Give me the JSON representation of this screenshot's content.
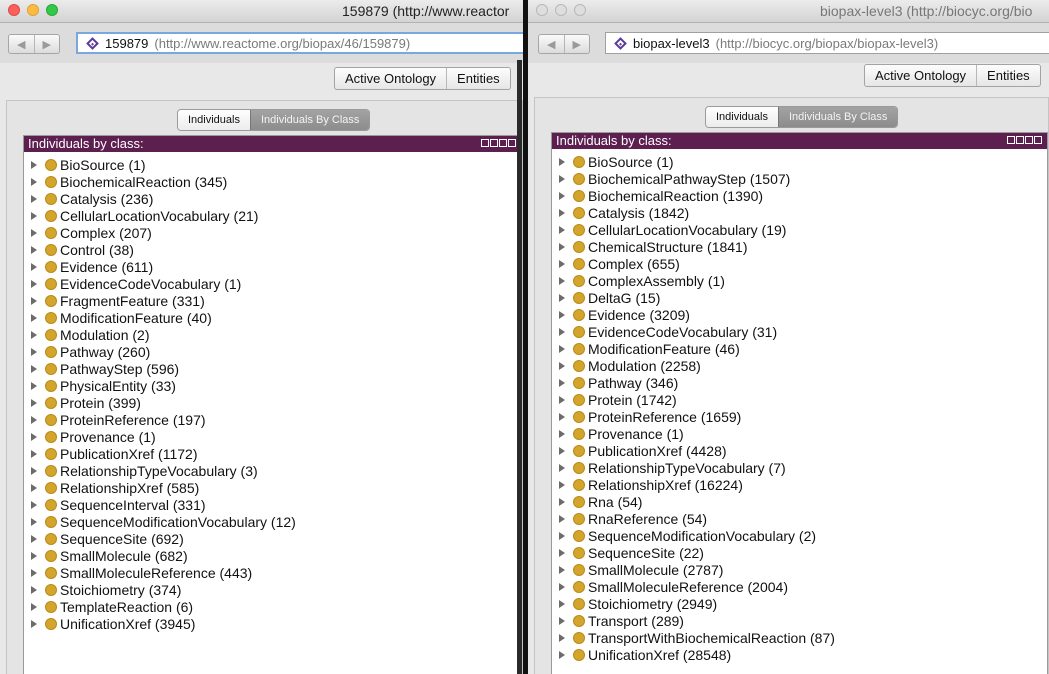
{
  "windows": [
    {
      "title": "159879 (http://www.reactor",
      "address": {
        "name": "159879",
        "url": "(http://www.reactome.org/biopax/46/159879)"
      },
      "tabs": [
        "Active Ontology",
        "Entities"
      ],
      "view_tabs": {
        "individuals": "Individuals",
        "by_class": "Individuals By Class"
      },
      "view_title": "Individuals by class:",
      "items": [
        "BioSource (1)",
        "BiochemicalReaction (345)",
        "Catalysis (236)",
        "CellularLocationVocabulary (21)",
        "Complex (207)",
        "Control (38)",
        "Evidence (611)",
        "EvidenceCodeVocabulary (1)",
        "FragmentFeature (331)",
        "ModificationFeature (40)",
        "Modulation (2)",
        "Pathway (260)",
        "PathwayStep (596)",
        "PhysicalEntity (33)",
        "Protein (399)",
        "ProteinReference (197)",
        "Provenance (1)",
        "PublicationXref (1172)",
        "RelationshipTypeVocabulary (3)",
        "RelationshipXref (585)",
        "SequenceInterval (331)",
        "SequenceModificationVocabulary (12)",
        "SequenceSite (692)",
        "SmallMolecule (682)",
        "SmallMoleculeReference (443)",
        "Stoichiometry (374)",
        "TemplateReaction (6)",
        "UnificationXref (3945)"
      ]
    },
    {
      "title": "biopax-level3 (http://biocyc.org/bio",
      "address": {
        "name": "biopax-level3",
        "url": "(http://biocyc.org/biopax/biopax-level3)"
      },
      "tabs": [
        "Active Ontology",
        "Entities"
      ],
      "view_tabs": {
        "individuals": "Individuals",
        "by_class": "Individuals By Class"
      },
      "view_title": "Individuals by class:",
      "items": [
        "BioSource (1)",
        "BiochemicalPathwayStep (1507)",
        "BiochemicalReaction (1390)",
        "Catalysis (1842)",
        "CellularLocationVocabulary (19)",
        "ChemicalStructure (1841)",
        "Complex (655)",
        "ComplexAssembly (1)",
        "DeltaG (15)",
        "Evidence (3209)",
        "EvidenceCodeVocabulary (31)",
        "ModificationFeature (46)",
        "Modulation (2258)",
        "Pathway (346)",
        "Protein (1742)",
        "ProteinReference (1659)",
        "Provenance (1)",
        "PublicationXref (4428)",
        "RelationshipTypeVocabulary (7)",
        "RelationshipXref (16224)",
        "Rna (54)",
        "RnaReference (54)",
        "SequenceModificationVocabulary (2)",
        "SequenceSite (22)",
        "SmallMolecule (2787)",
        "SmallMoleculeReference (2004)",
        "Stoichiometry (2949)",
        "Transport (289)",
        "TransportWithBiochemicalReaction (87)",
        "UnificationXref (28548)"
      ]
    }
  ]
}
